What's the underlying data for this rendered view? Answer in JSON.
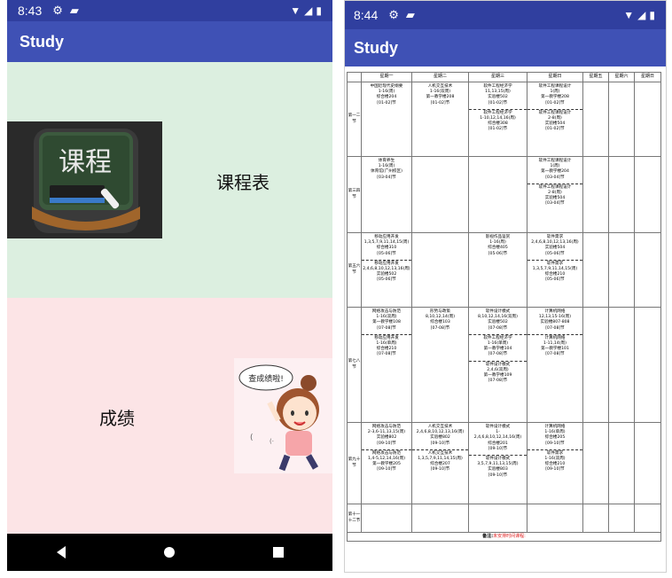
{
  "left": {
    "status": {
      "time": "8:43"
    },
    "app_title": "Study",
    "schedule_card": {
      "label": "课程表",
      "icon_text": "课程"
    },
    "grades_card": {
      "label": "成绩",
      "sticker_text": "查成绩啦!"
    }
  },
  "right": {
    "status": {
      "time": "8:44"
    },
    "app_title": "Study",
    "timetable": {
      "headers": [
        "",
        "星期一",
        "星期二",
        "星期三",
        "星期日",
        "星期五",
        "星期六",
        "星期日"
      ],
      "periods": [
        "第一二节",
        "第三四节",
        "第五六节",
        "第七八节",
        "第九十节",
        "第十一十二节"
      ],
      "rows": [
        [
          [
            [
              "中国近现代史纲要",
              "1-16(周)",
              "综合楼204",
              "[01-02]节"
            ]
          ],
          [
            [
              "人机交互技术",
              "1-16(双周)",
              "第一教学楼208",
              "[01-02]节"
            ]
          ],
          [
            [
              "软件工程经济学",
              "11,13,15(周)",
              "实验楼502",
              "[01-02]节"
            ],
            [
              "软件工程经济学",
              "1-10,12,14,16(周)",
              "综合楼308",
              "[01-02]节"
            ]
          ],
          [
            [
              "软件工程课程设计",
              "1(周)",
              "第一教学楼208",
              "[01-02]节"
            ],
            [
              "软件工程课程设计",
              "2-8(周)",
              "实验楼504",
              "[01-02]节"
            ]
          ],
          [],
          [],
          []
        ],
        [
          [
            [
              "体育养生",
              "1-16(周)",
              "体育馆(广州校区)",
              "[03-04]节"
            ]
          ],
          [],
          [],
          [
            [
              "软件工程课程设计",
              "1(周)",
              "第一教学楼204",
              "[03-04]节"
            ],
            [
              "软件工程课程设计",
              "2-8(周)",
              "实验楼504",
              "[03-04]节"
            ]
          ],
          [],
          [],
          []
        ],
        [
          [
            [
              "移动应用开发",
              "1,3,5,7,9,11,14,15(周)",
              "综合楼310",
              "[05-06]节"
            ],
            [
              "移动应用开发",
              "2,4,6,8,10,12,13,16(周)",
              "实验楼502",
              "[05-06]节"
            ]
          ],
          [],
          [
            [
              "影视作品鉴赏",
              "1-16(周)",
              "综合楼405",
              "[05-06]节"
            ]
          ],
          [
            [
              "软件需求",
              "2,4,6,8,10,12,13,16(周)",
              "实验楼504",
              "[05-06]节"
            ],
            [
              "软件需求",
              "1,3,5,7,9,11,14,15(周)",
              "综合楼210",
              "[05-06]节"
            ]
          ],
          [],
          [],
          []
        ],
        [
          [
            [
              "网络攻击与防范",
              "1-16(双周)",
              "第一教学楼108",
              "[07-08]节"
            ],
            [
              "移动应用开发",
              "1-16(单周)",
              "综合楼210",
              "[07-08]节"
            ]
          ],
          [
            [
              "形势与政策",
              "8,10,12,14(周)",
              "综合楼103",
              "[07-08]节"
            ]
          ],
          [
            [
              "软件设计模式",
              "8,10,12,14,16(双周)",
              "实验楼502",
              "[07-08]节"
            ],
            [
              "软件工程经济学",
              "1-16(单周)",
              "第一教学楼104",
              "[07-08]节"
            ],
            [
              "软件设计模式",
              "2,4,6(双周)",
              "第一教学楼109",
              "[07-08]节"
            ]
          ],
          [
            [
              "计算机网络",
              "12,13,15-16(周)",
              "实验楼807-808",
              "[07-08]节"
            ],
            [
              "计算机网络",
              "1-11,14(周)",
              "第一教学楼101",
              "[07-08]节"
            ]
          ],
          [],
          [],
          []
        ],
        [
          [
            [
              "网络攻击与防范",
              "2-3,6-11,13,15(周)",
              "实验楼802",
              "[09-10]节"
            ],
            [
              "网络攻击与防范",
              "1,4-5,12,14,16(周)",
              "第一教学楼205",
              "[09-10]节"
            ]
          ],
          [
            [
              "人机交互技术",
              "2,4,6,8,10,12,13,16(周)",
              "实验楼802",
              "[09-10]节"
            ],
            [
              "人机交互技术",
              "1,3,5,7,9,11,14,15(周)",
              "综合楼207",
              "[09-10]节"
            ]
          ],
          [
            [
              "软件设计模式",
              "1-",
              "2,4,6,8,10,12,14,16(周)",
              "综合楼201",
              "[09-10]节"
            ],
            [
              "软件设计模式",
              "3,5,7,9,11,13,15(周)",
              "实验楼803",
              "[09-10]节"
            ]
          ],
          [
            [
              "计算机网络",
              "1-16(单周)",
              "综合楼205",
              "[09-10]节"
            ],
            [
              "软件需求",
              "1-16(双周)",
              "综合楼210",
              "[09-10]节"
            ]
          ],
          [],
          [],
          []
        ],
        [
          [],
          [],
          [],
          [],
          [],
          [],
          []
        ]
      ],
      "note_label": "备注:",
      "note_text": "未安排时间课程:"
    }
  },
  "colors": {
    "status_bar": "#303f9f",
    "app_bar": "#3f51b5",
    "schedule_card_bg": "#dcefe0",
    "grades_card_bg": "#fce4e6",
    "note_red": "#e02020"
  },
  "icons": [
    "gear-icon",
    "sd-card-icon",
    "wifi-icon",
    "signal-icon",
    "battery-icon",
    "back-icon",
    "home-icon",
    "recents-icon"
  ]
}
